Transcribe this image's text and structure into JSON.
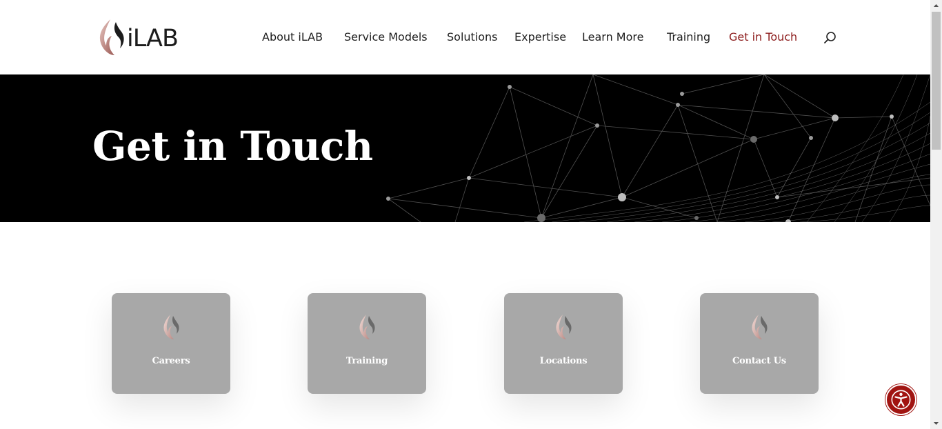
{
  "brand": {
    "logo_text": "iLAB",
    "accent": "#8c1b1b"
  },
  "nav": {
    "items": [
      {
        "label": "About iLAB"
      },
      {
        "label": "Service Models"
      },
      {
        "label": "Solutions"
      },
      {
        "label": "Expertise"
      },
      {
        "label": "Learn More"
      },
      {
        "label": "Training"
      },
      {
        "label": "Get in Touch",
        "active": true
      }
    ],
    "search_icon": "search-icon"
  },
  "hero": {
    "title": "Get in Touch",
    "background": "#000000"
  },
  "cards": [
    {
      "label": "Careers",
      "icon": "flame-logo-icon"
    },
    {
      "label": "Training",
      "icon": "flame-logo-icon"
    },
    {
      "label": "Locations",
      "icon": "flame-logo-icon"
    },
    {
      "label": "Contact Us",
      "icon": "flame-logo-icon"
    }
  ],
  "accessibility": {
    "icon": "accessibility-icon",
    "color": "#a11411"
  }
}
